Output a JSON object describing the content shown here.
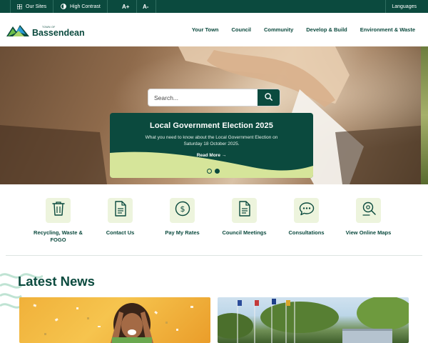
{
  "utility_bar": {
    "our_sites": "Our Sites",
    "high_contrast": "High Contrast",
    "font_increase": "A+",
    "font_decrease": "A-",
    "languages": "Languages"
  },
  "header": {
    "logo_small": "TOWN OF",
    "logo_main": "Bassendean",
    "nav": [
      "Your Town",
      "Council",
      "Community",
      "Develop & Build",
      "Environment & Waste"
    ]
  },
  "hero": {
    "search_placeholder": "Search...",
    "banner_title": "Local Government Election 2025",
    "banner_description": "What you need to know about the Local Government Election on Saturday 18 October 2025.",
    "banner_link": "Read More →",
    "slide_count": 2,
    "active_slide": 2
  },
  "quick_links": [
    {
      "label": "Recycling, Waste & FOGO",
      "icon": "trash-bin-icon"
    },
    {
      "label": "Contact Us",
      "icon": "document-icon"
    },
    {
      "label": "Pay My Rates",
      "icon": "dollar-icon"
    },
    {
      "label": "Council Meetings",
      "icon": "document-icon"
    },
    {
      "label": "Consultations",
      "icon": "chat-bubble-icon"
    },
    {
      "label": "View Online Maps",
      "icon": "map-pin-icon"
    }
  ],
  "news": {
    "title": "Latest News"
  },
  "colors": {
    "brand_dark_green": "#0b4a3e",
    "accent_light_green": "#d6e59a",
    "icon_tile_bg": "#edf4dd"
  }
}
